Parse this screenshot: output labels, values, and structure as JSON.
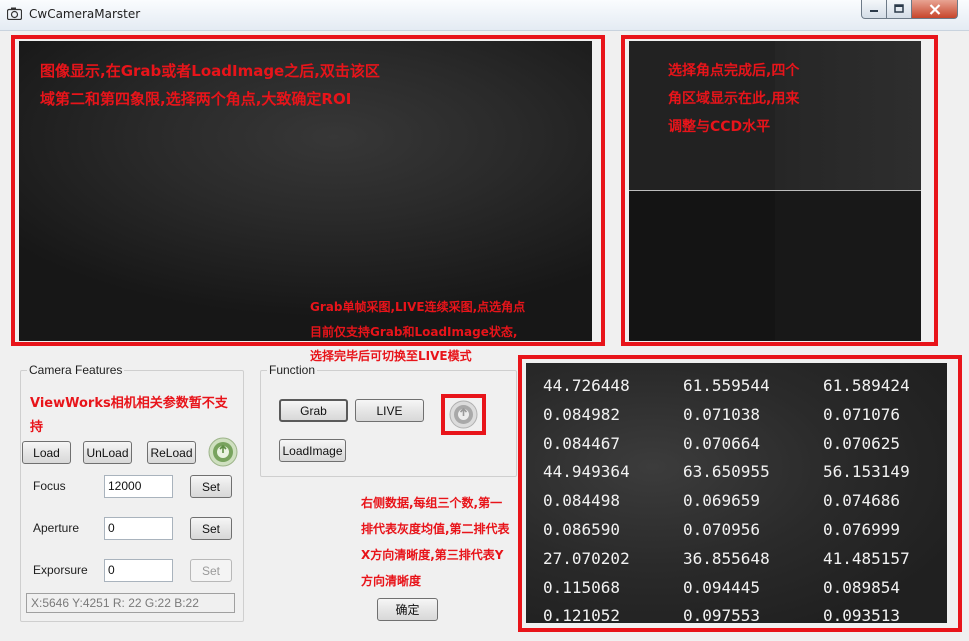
{
  "window": {
    "title": "CwCameraMarster"
  },
  "main_view": {
    "note_lines": [
      "图像显示,在Grab或者LoadImage之后,双击该区",
      "域第二和第四象限,选择两个角点,大致确定ROI"
    ]
  },
  "roi_view": {
    "note_lines": [
      "选择角点完成后,四个",
      "角区域显示在此,用来",
      "调整与CCD水平"
    ]
  },
  "grab_note": {
    "lines": [
      "Grab单帧采图,LIVE连续采图,点选角点",
      "目前仅支持Grab和LoadImage状态,",
      "选择完毕后可切换至LIVE模式"
    ]
  },
  "camera_features": {
    "title": "Camera Features",
    "note_lines": [
      "ViewWorks相机相关参数暂不支",
      "持"
    ],
    "load_label": "Load",
    "unload_label": "UnLoad",
    "reload_label": "ReLoad",
    "focus_label": "Focus",
    "focus_value": "12000",
    "aperture_label": "Aperture",
    "aperture_value": "0",
    "exposure_label": "Exporsure",
    "exposure_value": "0",
    "set_label": "Set"
  },
  "function_group": {
    "title": "Function",
    "grab_label": "Grab",
    "live_label": "LIVE",
    "loadimage_label": "LoadImage"
  },
  "status": {
    "text": "X:5646  Y:4251  R:  22  G:22   B:22"
  },
  "data_view": {
    "rows": [
      [
        "44.726448",
        "61.559544",
        "61.589424"
      ],
      [
        "0.084982",
        "0.071038",
        "0.071076"
      ],
      [
        "0.084467",
        "0.070664",
        "0.070625"
      ],
      [
        "44.949364",
        "63.650955",
        "56.153149"
      ],
      [
        "0.084498",
        "0.069659",
        "0.074686"
      ],
      [
        "0.086590",
        "0.070956",
        "0.076999"
      ],
      [
        "27.070202",
        "36.855648",
        "41.485157"
      ],
      [
        "0.115068",
        "0.094445",
        "0.089854"
      ],
      [
        "0.121052",
        "0.097553",
        "0.093513"
      ]
    ],
    "note_lines": [
      "右侧数据,每组三个数,第一",
      "排代表灰度均值,第二排代表",
      "X方向清晰度,第三排代表Y",
      "方向清晰度"
    ]
  },
  "confirm_label": "确定",
  "colors": {
    "annotation": "#e8141a",
    "background": "#f0f0f0"
  }
}
